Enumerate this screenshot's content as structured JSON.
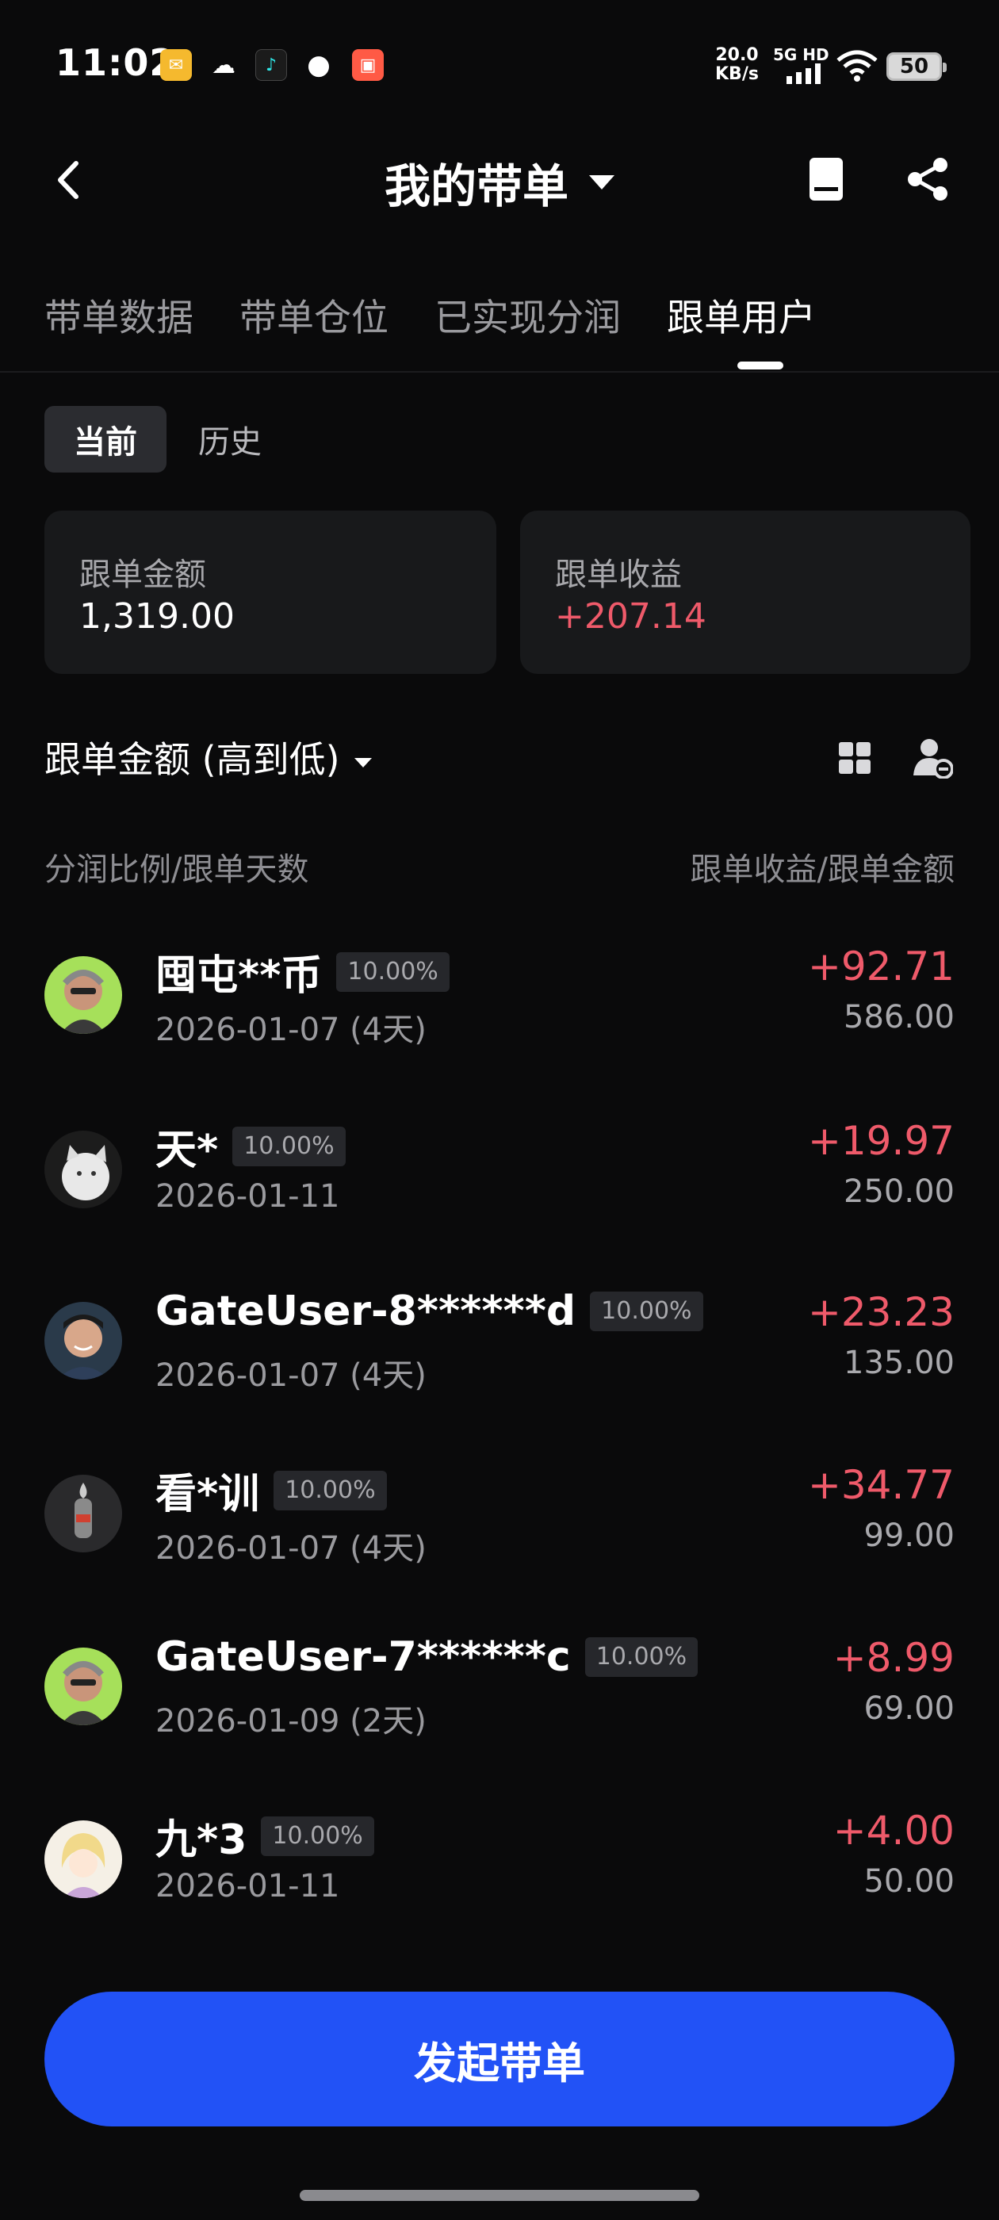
{
  "status": {
    "time": "11:02",
    "net_speed_top": "20.0",
    "net_speed_bottom": "KB/s",
    "network": "5G HD",
    "battery": "50"
  },
  "nav": {
    "title": "我的带单"
  },
  "tabs": [
    {
      "label": "带单数据"
    },
    {
      "label": "带单仓位"
    },
    {
      "label": "已实现分润"
    },
    {
      "label": "跟单用户"
    }
  ],
  "segment": {
    "current": "当前",
    "history": "历史"
  },
  "summary": {
    "amount_label": "跟单金额",
    "amount_value": "1,319.00",
    "profit_label": "跟单收益",
    "profit_value": "+207.14"
  },
  "sort": {
    "label": "跟单金额 (高到低)"
  },
  "columns": {
    "left": "分润比例/跟单天数",
    "right": "跟单收益/跟单金额"
  },
  "rows": [
    {
      "name": "囤屯**币",
      "ratio": "10.00%",
      "date": "2026-01-07 (4天)",
      "profit": "+92.71",
      "amount": "586.00"
    },
    {
      "name": "天*",
      "ratio": "10.00%",
      "date": "2026-01-11",
      "profit": "+19.97",
      "amount": "250.00"
    },
    {
      "name": "GateUser-8******d",
      "ratio": "10.00%",
      "date": "2026-01-07 (4天)",
      "profit": "+23.23",
      "amount": "135.00"
    },
    {
      "name": "看*训",
      "ratio": "10.00%",
      "date": "2026-01-07 (4天)",
      "profit": "+34.77",
      "amount": "99.00"
    },
    {
      "name": "GateUser-7******c",
      "ratio": "10.00%",
      "date": "2026-01-09 (2天)",
      "profit": "+8.99",
      "amount": "69.00"
    },
    {
      "name": "九*3",
      "ratio": "10.00%",
      "date": "2026-01-11",
      "profit": "+4.00",
      "amount": "50.00"
    }
  ],
  "cta": {
    "label": "发起带单"
  },
  "colors": {
    "accent": "#2252f6",
    "profit": "#ef5a6a",
    "background": "#0a0a0b"
  }
}
